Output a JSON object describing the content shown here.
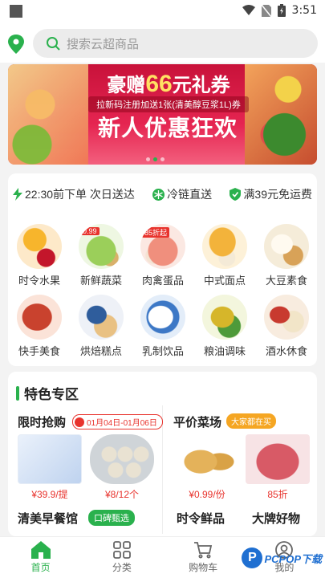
{
  "status_bar": {
    "time": "3:51"
  },
  "search": {
    "placeholder": "搜索云超商品"
  },
  "banner": {
    "headline_prefix": "豪赠",
    "headline_amount": "66",
    "headline_suffix": "元礼券",
    "subline": "拉新码注册加送1张(清美醇豆浆1L)券",
    "big_text": "新人优惠狂欢"
  },
  "promises": [
    {
      "icon": "lightning-icon",
      "text": "22:30前下单 次日送达"
    },
    {
      "icon": "snowflake-icon",
      "text": "冷链直送"
    },
    {
      "icon": "shield-icon",
      "text": "满39元免运费"
    }
  ],
  "categories": [
    {
      "label": "时令水果",
      "tag": ""
    },
    {
      "label": "新鲜蔬菜",
      "tag": "0.99"
    },
    {
      "label": "肉禽蛋品",
      "tag": "85折起"
    },
    {
      "label": "中式面点",
      "tag": ""
    },
    {
      "label": "大豆素食",
      "tag": ""
    },
    {
      "label": "快手美食",
      "tag": ""
    },
    {
      "label": "烘焙糕点",
      "tag": ""
    },
    {
      "label": "乳制饮品",
      "tag": ""
    },
    {
      "label": "粮油调味",
      "tag": ""
    },
    {
      "label": "酒水休食",
      "tag": ""
    }
  ],
  "zone": {
    "title": "特色专区",
    "flash": {
      "title": "限时抢购",
      "date": "01月04日-01月06日",
      "price1": "¥39.9/提",
      "price2": "¥8/12个"
    },
    "cheap": {
      "title": "平价菜场",
      "badge": "大家都在买",
      "price1": "¥0.99/份",
      "price2": "85折"
    },
    "breakfast": {
      "title": "清美早餐馆",
      "badge": "口碑甄选"
    },
    "seasonal": {
      "title": "时令鲜品"
    },
    "brand": {
      "title": "大牌好物"
    }
  },
  "nav": [
    {
      "label": "首页",
      "active": true
    },
    {
      "label": "分类",
      "active": false
    },
    {
      "label": "购物车",
      "active": false
    },
    {
      "label": "我的",
      "active": false
    }
  ],
  "watermark": {
    "text": "PCPOP下载"
  },
  "colors": {
    "accent": "#2ab14d",
    "price": "#e8332d",
    "banner": "#d81b44"
  }
}
